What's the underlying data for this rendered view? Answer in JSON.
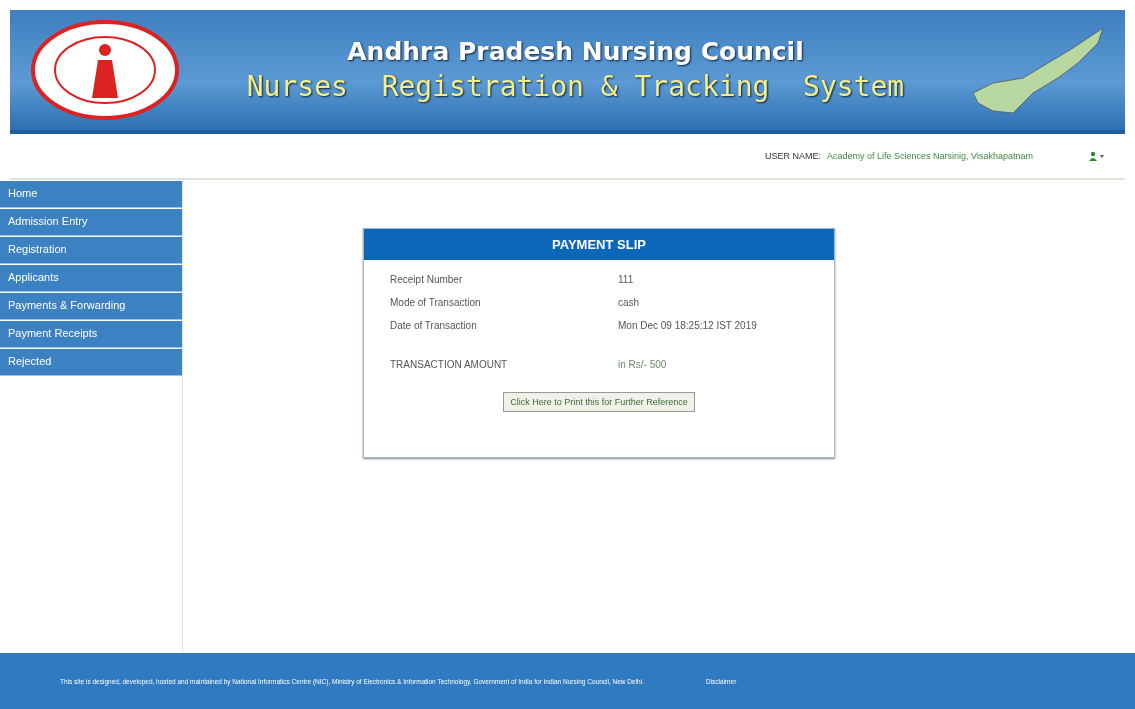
{
  "header": {
    "council": "Andhra Pradesh Nursing Council",
    "system": "Nurses  Registration & Tracking  System"
  },
  "user_bar": {
    "label": "USER NAME:",
    "value": "Academy of Life Sciences Narsinig, Visakhapatnam"
  },
  "sidebar": {
    "items": [
      {
        "label": "Home"
      },
      {
        "label": "Admission Entry"
      },
      {
        "label": "Registration"
      },
      {
        "label": "Applicants"
      },
      {
        "label": "Payments & Forwarding"
      },
      {
        "label": "Payment Receipts"
      },
      {
        "label": "Rejected"
      }
    ]
  },
  "slip": {
    "title": "PAYMENT SLIP",
    "rows": [
      {
        "label": "Receipt Number",
        "value": "111"
      },
      {
        "label": "Mode of Transaction",
        "value": "cash"
      },
      {
        "label": "Date of Transaction",
        "value": "Mon Dec 09 18:25:12 IST 2019"
      }
    ],
    "amount": {
      "label": "TRANSACTION AMOUNT",
      "value": "in Rs/- 500"
    },
    "button": "Click Here to Print this for Further Reference"
  },
  "footer": {
    "text": "This site is designed, developed, hosted and maintained by National Informatics Centre (NIC), Ministry of Electronics & Information Technology, Government of India for Indian Nursing Council, New Delhi.",
    "link": "Disclaimer"
  }
}
